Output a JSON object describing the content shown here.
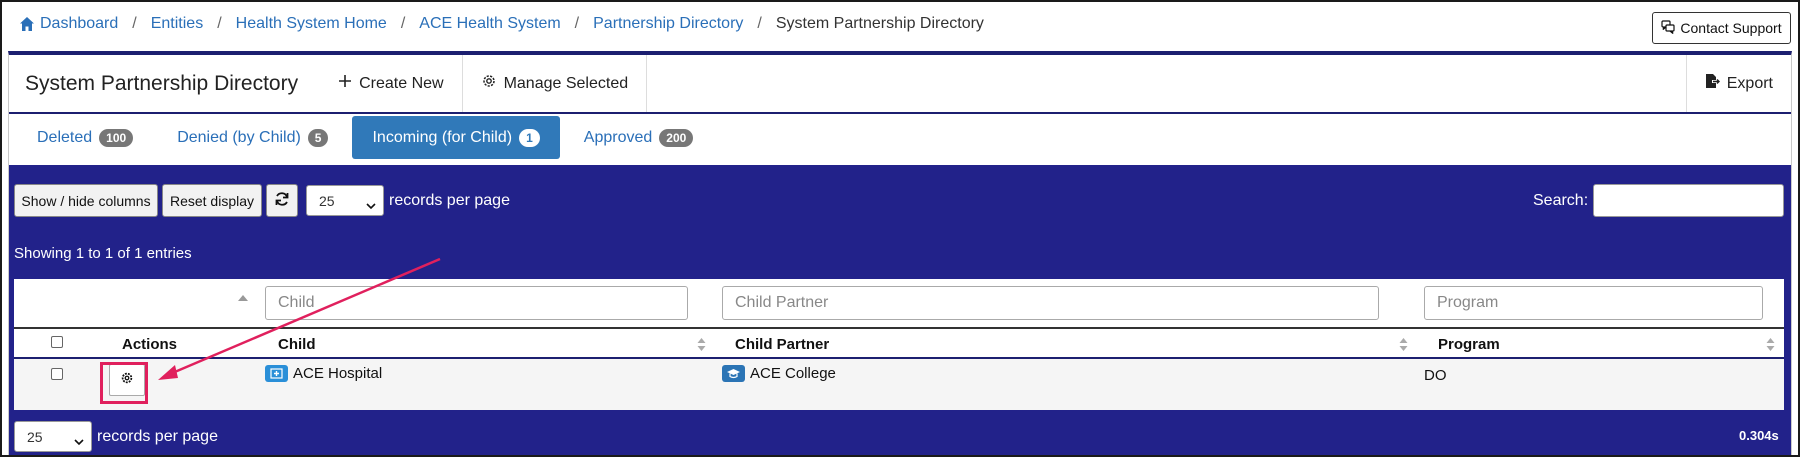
{
  "breadcrumb": [
    {
      "label": "Dashboard"
    },
    {
      "label": "Entities"
    },
    {
      "label": "Health System Home"
    },
    {
      "label": "ACE Health System"
    },
    {
      "label": "Partnership Directory"
    }
  ],
  "breadcrumb_current": "System Partnership Directory",
  "contact_support": "Contact Support",
  "header": {
    "title": "System Partnership Directory",
    "create_new": "Create New",
    "manage_selected": "Manage Selected",
    "export": "Export"
  },
  "tabs": [
    {
      "label": "Deleted",
      "count": "100"
    },
    {
      "label": "Denied (by Child)",
      "count": "5"
    },
    {
      "label": "Incoming (for Child)",
      "count": "1"
    },
    {
      "label": "Approved",
      "count": "200"
    }
  ],
  "toolbar": {
    "show_hide": "Show / hide columns",
    "reset": "Reset display",
    "page_size": "25",
    "records_per_page": "records per page",
    "search_label": "Search:"
  },
  "info": "Showing 1 to 1 of 1 entries",
  "filters": {
    "child": "Child",
    "child_partner": "Child Partner",
    "program": "Program"
  },
  "columns": {
    "actions": "Actions",
    "child": "Child",
    "child_partner": "Child Partner",
    "program": "Program"
  },
  "rows": [
    {
      "child": "ACE Hospital",
      "child_partner": "ACE College",
      "program": "DO"
    }
  ],
  "footer": {
    "page_size": "25",
    "records_per_page": "records per page",
    "timing": "0.304s"
  },
  "colors": {
    "navy": "#22228a",
    "link": "#2a6fb8",
    "active_tab": "#3079b9",
    "highlight": "#e0205d"
  }
}
